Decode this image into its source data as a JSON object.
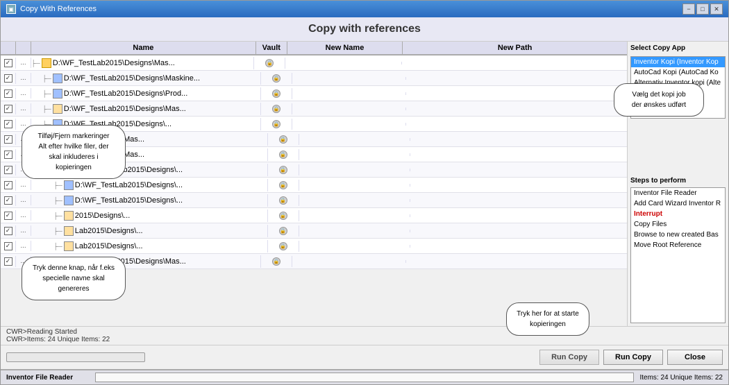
{
  "window": {
    "title": "Copy With References",
    "header": "Copy with references"
  },
  "title_buttons": {
    "minimize": "−",
    "maximize": "□",
    "close": "✕"
  },
  "table": {
    "headers": {
      "name": "Name",
      "vault": "Vault",
      "new_name": "New Name",
      "new_path": "New Path"
    },
    "rows": [
      {
        "checked": true,
        "indent": 1,
        "name": "D:\\WF_TestLab2015\\Designs\\Mas...",
        "icon": "folder",
        "locked": true
      },
      {
        "checked": true,
        "indent": 2,
        "name": "D:\\WF_TestLab2015\\Designs\\Maskine...",
        "icon": "file-blue",
        "locked": true
      },
      {
        "checked": true,
        "indent": 2,
        "name": "D:\\WF_TestLab2015\\Designs\\Prod...",
        "icon": "file-blue",
        "locked": true
      },
      {
        "checked": true,
        "indent": 2,
        "name": "D:\\WF_TestLab2015\\Designs\\Mas...",
        "icon": "file",
        "locked": true
      },
      {
        "checked": true,
        "indent": 2,
        "name": "D:\\WF_TestLab2015\\Designs\\...",
        "icon": "file-blue",
        "locked": true
      },
      {
        "checked": true,
        "indent": 3,
        "name": "2015\\Designs\\Mas...",
        "icon": "file",
        "locked": true
      },
      {
        "checked": true,
        "indent": 3,
        "name": "2015\\Designs\\Mas...",
        "icon": "file",
        "locked": true
      },
      {
        "checked": true,
        "indent": 3,
        "name": "D:\\WF_TestLab2015\\Designs\\...",
        "icon": "file-blue",
        "locked": true
      },
      {
        "checked": true,
        "indent": 3,
        "name": "D:\\WF_TestLab2015\\Designs\\...",
        "icon": "file-blue",
        "locked": true
      },
      {
        "checked": true,
        "indent": 3,
        "name": "D:\\WF_TestLab2015\\Designs\\...",
        "icon": "file-blue",
        "locked": true
      },
      {
        "checked": true,
        "indent": 3,
        "name": "2015\\Designs\\...",
        "icon": "file",
        "locked": true
      },
      {
        "checked": true,
        "indent": 3,
        "name": "Lab2015\\Designs\\...",
        "icon": "file",
        "locked": true
      },
      {
        "checked": true,
        "indent": 3,
        "name": "Lab2015\\Designs\\...",
        "icon": "file",
        "locked": true
      },
      {
        "checked": true,
        "indent": 2,
        "name": "D:\\WF_TestLab2015\\Designs\\Mas...",
        "icon": "folder",
        "locked": true
      }
    ]
  },
  "right_panel": {
    "select_copy_label": "Select Copy App",
    "copy_apps": [
      {
        "label": "Inventor Kopi (Inventor Kop",
        "selected": true
      },
      {
        "label": "AutoCad Kopi (AutoCad Ko",
        "selected": false
      },
      {
        "label": "Alternativ Inventor kopi (Alte",
        "selected": false
      }
    ],
    "tooltip_select": "Vælg det kopi job der ønskes udført",
    "steps_label": "Steps to perform",
    "steps": [
      {
        "label": "Inventor File Reader",
        "active": false
      },
      {
        "label": "Add Card Wizard Inventor R",
        "active": false
      },
      {
        "label": "Interrupt",
        "active": true
      },
      {
        "label": "Copy Files",
        "active": false
      },
      {
        "label": "Browse to new created Bas",
        "active": false
      },
      {
        "label": "Move Root Reference",
        "active": false
      }
    ]
  },
  "tooltips": {
    "left_1": "Tilføj/Fjern markeringer\nAlt efter hvilke filer, der skal inkluderes i kopieringen",
    "left_2": "Tryk denne knap, når f.eks specielle navne skal genereres",
    "bottom": "Tryk her for at starte kopieringen"
  },
  "status": {
    "line1": "CWR>Reading Started",
    "line2": "CWR>Items: 24 Unique Items: 22"
  },
  "buttons": {
    "run_copy": "Run Copy",
    "close": "Close"
  },
  "taskbar": {
    "left": "Inventor File Reader",
    "items": "Items: 24 Unique Items: 22"
  }
}
